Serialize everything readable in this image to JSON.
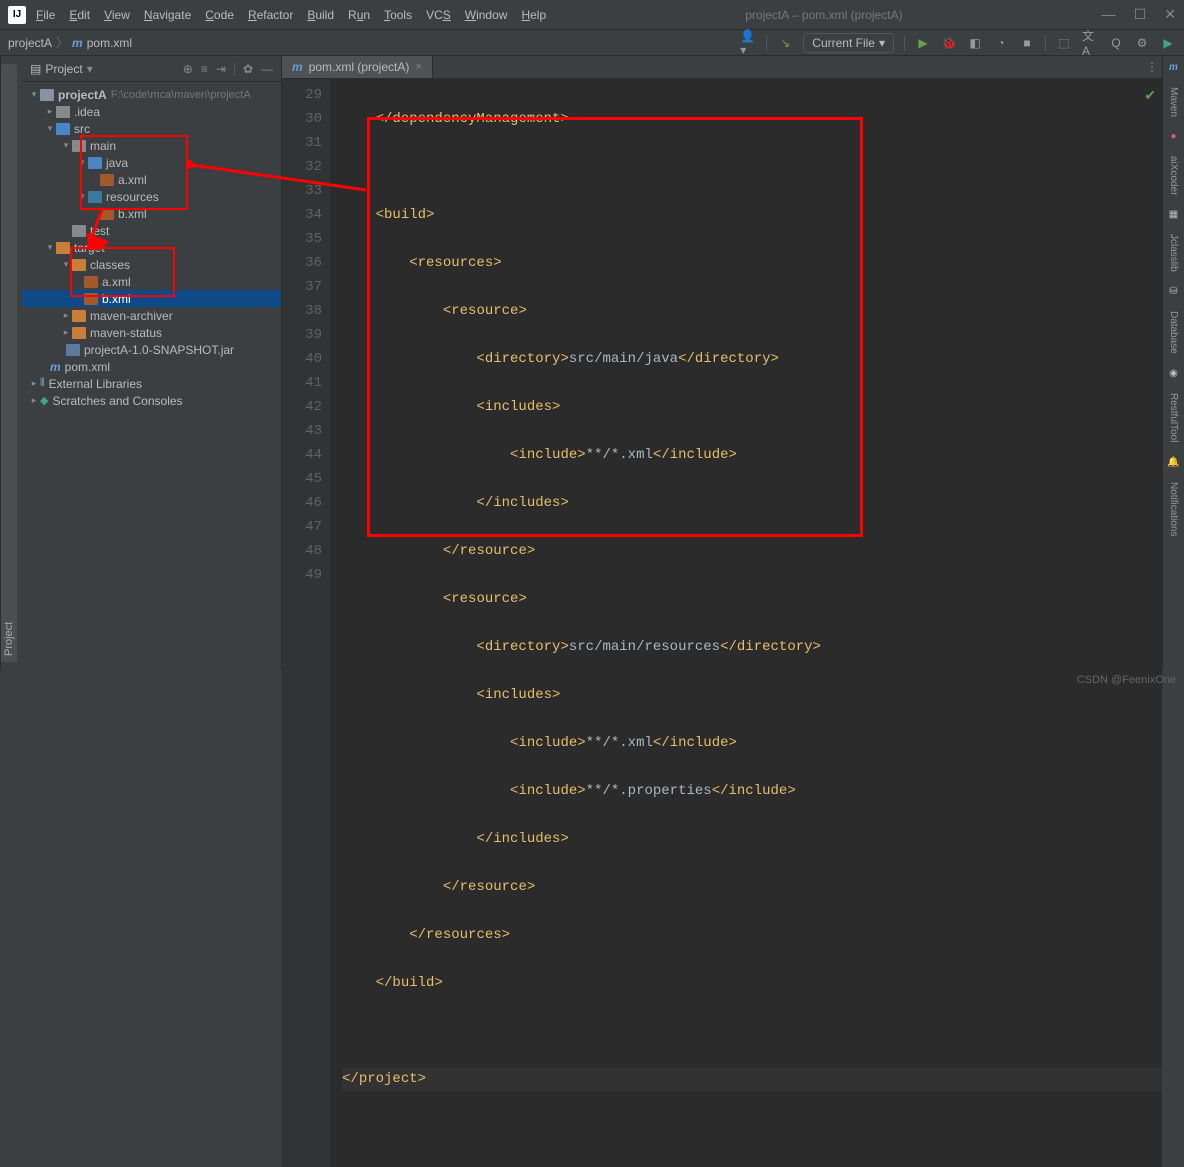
{
  "window": {
    "title": "projectA – pom.xml (projectA)"
  },
  "menu": [
    "File",
    "Edit",
    "View",
    "Navigate",
    "Code",
    "Refactor",
    "Build",
    "Run",
    "Tools",
    "VCS",
    "Window",
    "Help"
  ],
  "breadcrumb": {
    "root": "projectA",
    "file": "pom.xml"
  },
  "runConfig": "Current File",
  "panel": {
    "title": "Project"
  },
  "tree": {
    "root": "projectA",
    "rootPath": "F:\\code\\mca\\maven\\projectA",
    "idea": ".idea",
    "src": "src",
    "main": "main",
    "java": "java",
    "a_xml": "a.xml",
    "resources": "resources",
    "b_xml": "b.xml",
    "test": "test",
    "target": "target",
    "classes": "classes",
    "a_xml2": "a.xml",
    "b_xml2": "b.xml",
    "archiver": "maven-archiver",
    "status": "maven-status",
    "jar": "projectA-1.0-SNAPSHOT.jar",
    "pom": "pom.xml",
    "ext": "External Libraries",
    "scr": "Scratches and Consoles"
  },
  "tab": {
    "label": "pom.xml (projectA)"
  },
  "rightTabs": [
    "Maven",
    "aiXcoder",
    "Jclasslib",
    "Database",
    "RestfulTool",
    "Notifications"
  ],
  "code": {
    "lines": [
      29,
      30,
      31,
      32,
      33,
      34,
      35,
      36,
      37,
      38,
      39,
      40,
      41,
      42,
      43,
      44,
      45,
      46,
      47,
      48,
      49
    ],
    "l29a": "</",
    "l29b": "dependencyManagement",
    "l29c": ">",
    "l31a": "<",
    "l31b": "build",
    "l31c": ">",
    "l32a": "<",
    "l32b": "resources",
    "l32c": ">",
    "l33a": "<",
    "l33b": "resource",
    "l33c": ">",
    "l34a": "<",
    "l34b": "directory",
    "l34c": ">",
    "l34d": "src/main/java",
    "l34e": "</",
    "l34f": "directory",
    "l34g": ">",
    "l35a": "<",
    "l35b": "includes",
    "l35c": ">",
    "l36a": "<",
    "l36b": "include",
    "l36c": ">",
    "l36d": "**/*.xml",
    "l36e": "</",
    "l36f": "include",
    "l36g": ">",
    "l37a": "</",
    "l37b": "includes",
    "l37c": ">",
    "l38a": "</",
    "l38b": "resource",
    "l38c": ">",
    "l39a": "<",
    "l39b": "resource",
    "l39c": ">",
    "l40a": "<",
    "l40b": "directory",
    "l40c": ">",
    "l40d": "src/main/resources",
    "l40e": "</",
    "l40f": "directory",
    "l40g": ">",
    "l41a": "<",
    "l41b": "includes",
    "l41c": ">",
    "l42a": "<",
    "l42b": "include",
    "l42c": ">",
    "l42d": "**/*.xml",
    "l42e": "</",
    "l42f": "include",
    "l42g": ">",
    "l43a": "<",
    "l43b": "include",
    "l43c": ">",
    "l43d": "**/*.properties",
    "l43e": "</",
    "l43f": "include",
    "l43g": ">",
    "l44a": "</",
    "l44b": "includes",
    "l44c": ">",
    "l45a": "</",
    "l45b": "resource",
    "l45c": ">",
    "l46a": "</",
    "l46b": "resources",
    "l46c": ">",
    "l47a": "</",
    "l47b": "build",
    "l47c": ">",
    "l49a": "</",
    "l49b": "project",
    "l49c": ">"
  },
  "footer": "CSDN @FeenixOne"
}
